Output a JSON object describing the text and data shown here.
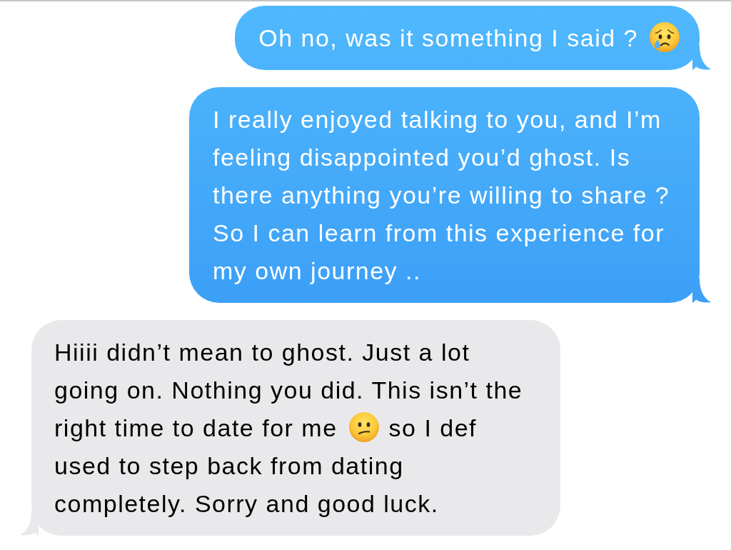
{
  "messages": [
    {
      "kind": "sent",
      "parts": [
        {
          "kind": "text",
          "text": "Oh no, was it something I said ?"
        },
        {
          "kind": "crying"
        }
      ]
    },
    {
      "kind": "sent",
      "parts": [
        {
          "kind": "text",
          "text": "I really enjoyed talking to you, and I’m feeling disappointed you’d ghost. Is there anything you’re willing to share ? So I can learn from this experience for my own journey .."
        }
      ]
    },
    {
      "kind": "received",
      "parts": [
        {
          "kind": "text",
          "text": "Hiiii didn’t mean to ghost. Just a lot going on. Nothing you did. This isn’t the right time to date for me"
        },
        {
          "kind": "confused"
        },
        {
          "kind": "text",
          "text": "so I def used to step back from dating completely. Sorry and good luck."
        }
      ]
    }
  ]
}
